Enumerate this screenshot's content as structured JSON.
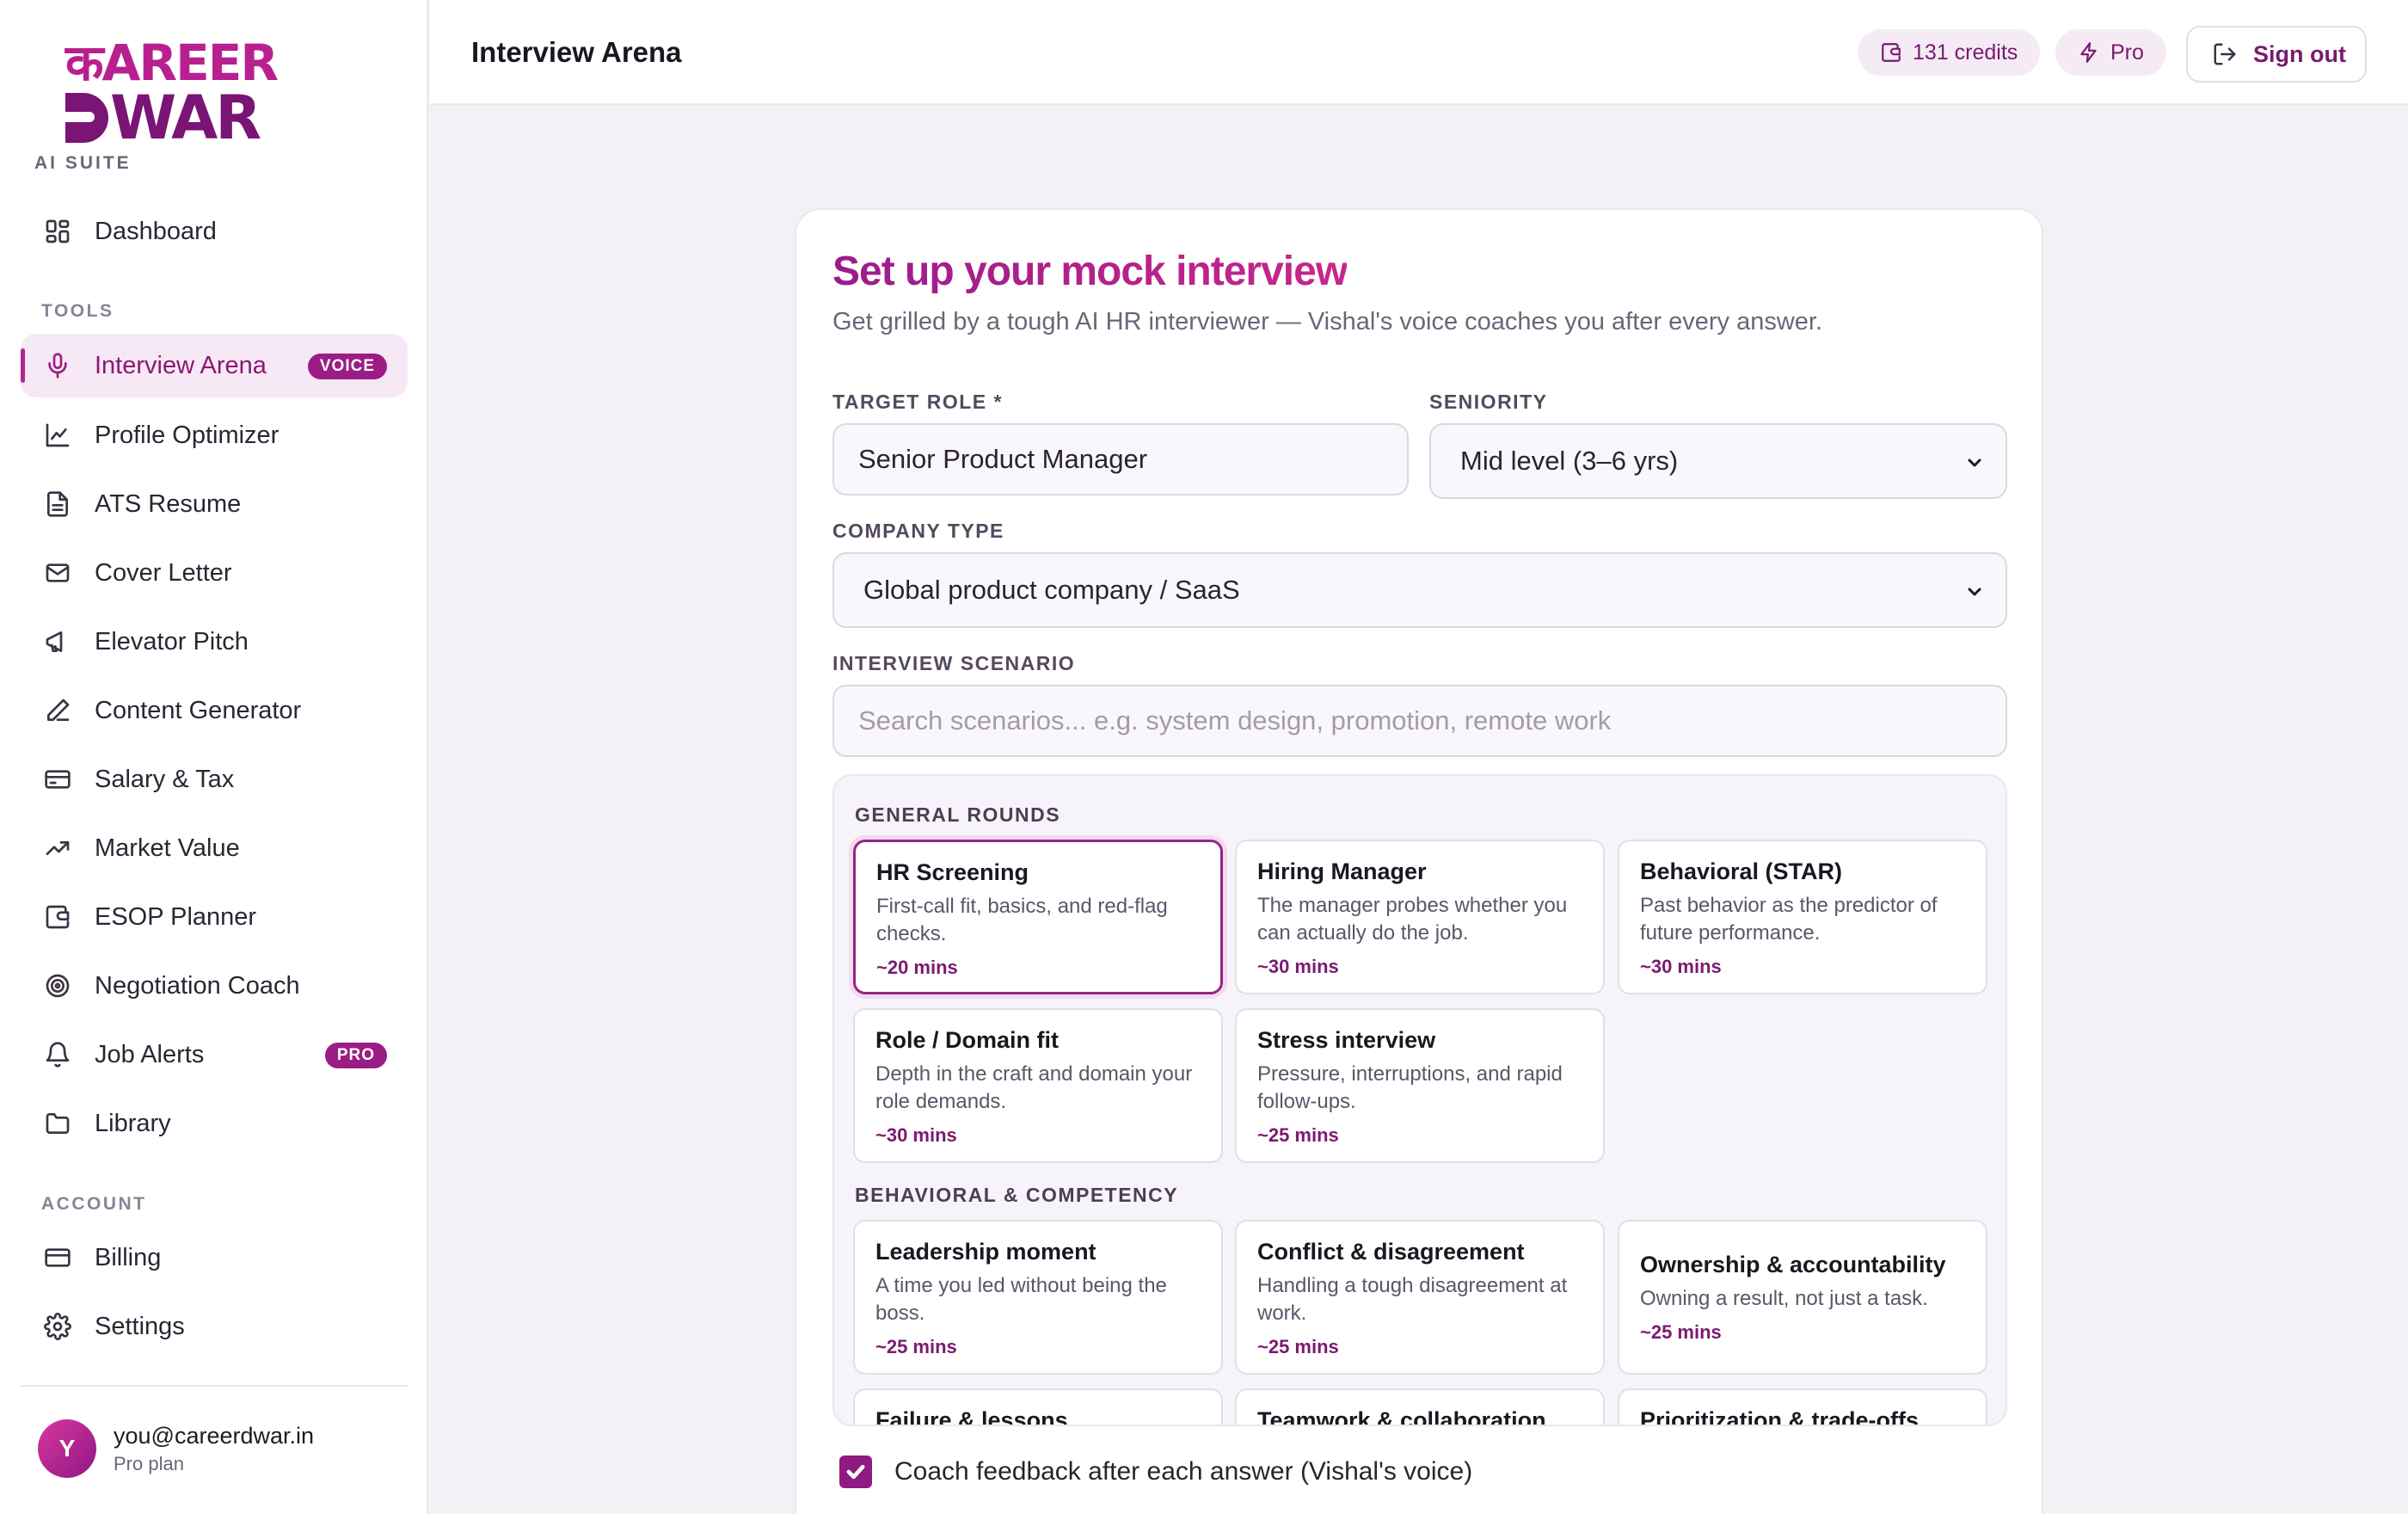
{
  "brand": {
    "logo_line1": "कAREER",
    "logo_line2": "WAR",
    "suite_label": "AI SUITE"
  },
  "sidebar": {
    "dashboard": "Dashboard",
    "tools_label": "TOOLS",
    "tools": [
      {
        "label": "Interview Arena",
        "icon": "mic-icon",
        "badge": "VOICE",
        "active": true
      },
      {
        "label": "Profile Optimizer",
        "icon": "line-chart-icon"
      },
      {
        "label": "ATS Resume",
        "icon": "document-icon"
      },
      {
        "label": "Cover Letter",
        "icon": "mail-icon"
      },
      {
        "label": "Elevator Pitch",
        "icon": "megaphone-icon"
      },
      {
        "label": "Content Generator",
        "icon": "pen-icon"
      },
      {
        "label": "Salary & Tax",
        "icon": "credit-card-icon"
      },
      {
        "label": "Market Value",
        "icon": "trending-up-icon"
      },
      {
        "label": "ESOP Planner",
        "icon": "wallet-icon"
      },
      {
        "label": "Negotiation Coach",
        "icon": "target-icon"
      },
      {
        "label": "Job Alerts",
        "icon": "bell-icon",
        "badge": "PRO"
      },
      {
        "label": "Library",
        "icon": "folder-icon"
      }
    ],
    "account_label": "ACCOUNT",
    "account": [
      {
        "label": "Billing",
        "icon": "card-icon"
      },
      {
        "label": "Settings",
        "icon": "gear-icon"
      }
    ],
    "user": {
      "initial": "Y",
      "email": "you@careerdwar.in",
      "plan": "Pro plan"
    }
  },
  "header": {
    "title": "Interview Arena",
    "credits": "131 credits",
    "plan": "Pro",
    "signout": "Sign out"
  },
  "form": {
    "title": "Set up your mock interview",
    "subtitle": "Get grilled by a tough AI HR interviewer — Vishal's voice coaches you after every answer.",
    "target_role_label": "TARGET ROLE *",
    "target_role_value": "Senior Product Manager",
    "seniority_label": "SENIORITY",
    "seniority_value": "Mid level (3–6 yrs)",
    "company_type_label": "COMPANY TYPE",
    "company_type_value": "Global product company / SaaS",
    "scenario_label": "INTERVIEW SCENARIO",
    "scenario_placeholder": "Search scenarios... e.g. system design, promotion, remote work",
    "groups": [
      {
        "label": "GENERAL ROUNDS",
        "cards": [
          {
            "title": "HR Screening",
            "desc": "First-call fit, basics, and red-flag checks.",
            "time": "~20 mins",
            "selected": true
          },
          {
            "title": "Hiring Manager",
            "desc": "The manager probes whether you can actually do the job.",
            "time": "~30 mins"
          },
          {
            "title": "Behavioral (STAR)",
            "desc": "Past behavior as the predictor of future performance.",
            "time": "~30 mins"
          },
          {
            "title": "Role / Domain fit",
            "desc": "Depth in the craft and domain your role demands.",
            "time": "~30 mins"
          },
          {
            "title": "Stress interview",
            "desc": "Pressure, interruptions, and rapid follow-ups.",
            "time": "~25 mins"
          }
        ]
      },
      {
        "label": "BEHAVIORAL & COMPETENCY",
        "cards": [
          {
            "title": "Leadership moment",
            "desc": "A time you led without being the boss.",
            "time": "~25 mins"
          },
          {
            "title": "Conflict & disagreement",
            "desc": "Handling a tough disagreement at work.",
            "time": "~25 mins"
          },
          {
            "title": "Ownership & accountability",
            "desc": "Owning a result, not just a task.",
            "time": "~25 mins"
          },
          {
            "title": "Failure & lessons",
            "desc": "",
            "time": ""
          },
          {
            "title": "Teamwork & collaboration",
            "desc": "",
            "time": ""
          },
          {
            "title": "Prioritization & trade-offs",
            "desc": "",
            "time": ""
          }
        ]
      }
    ],
    "coach_feedback_label": "Coach feedback after each answer (Vishal's voice)",
    "coach_feedback_checked": true
  },
  "colors": {
    "accent": "#9b1f85",
    "accent_light": "#f6e8f4",
    "background": "#f3f1f6"
  }
}
